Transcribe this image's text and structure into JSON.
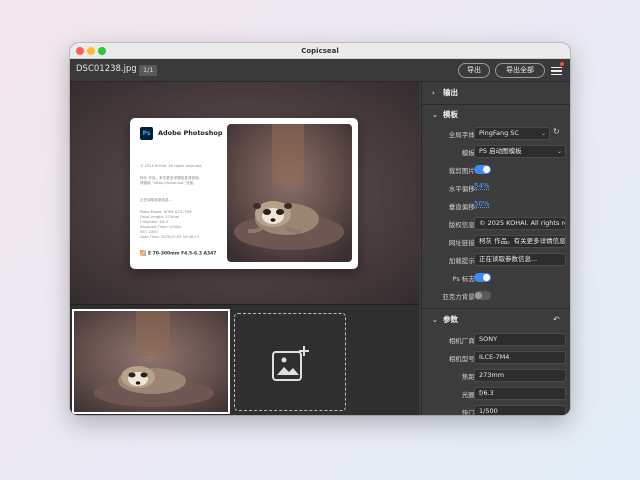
{
  "window": {
    "title": "Copicseal"
  },
  "toolbar": {
    "filename": "DSC01238.jpg",
    "count": "1/1",
    "export_label": "导出",
    "export_all_label": "导出全部",
    "menu_icon": "hamburger-menu-icon"
  },
  "card": {
    "app_icon_label": "Ps",
    "app_name": "Adobe Photoshop",
    "copyright": "© 2025 KOHAI. All rights reserved.",
    "description_1": "柯灰 作品。有关更多详情信息请参阅,",
    "description_2": "请链接 \"https://kohai.top\" 页面。",
    "loading": "正在读取参数信息...",
    "exif_lines": [
      "Make Model: SONY ILCE-7M4",
      "Focal Length: 273mm",
      "F Number: f/6.3",
      "Exposure Time: 1/500s",
      "ISO: 1000",
      "Date Time: 2025:07:05 10:08:23"
    ],
    "lens": "E 70-300mm F4.5-6.3 A347"
  },
  "panel": {
    "output_section": "输出",
    "template_section": "模板",
    "params_section": "参数",
    "template_rows": [
      {
        "label": "全局字体:",
        "value": "PingFang SC"
      },
      {
        "label": "模板:",
        "value": "PS 启动图模板"
      },
      {
        "label": "裁剪图片:",
        "toggle": "on"
      },
      {
        "label": "水平偏移:",
        "value": "54%"
      },
      {
        "label": "垂直偏移:",
        "value": "50%"
      },
      {
        "label": "版权信息:",
        "value": "© 2025 KOHAI. All rights reserved."
      },
      {
        "label": "网址链接:",
        "value": "柯灰 作品。有关更多详情信息请参阅"
      },
      {
        "label": "加载提示:",
        "value": "正在读取参数信息..."
      },
      {
        "label": "Ps 标志:",
        "toggle": "on"
      },
      {
        "label": "亚克力背景:",
        "toggle": "off"
      }
    ],
    "param_rows": [
      {
        "label": "相机厂商:",
        "value": "SONY"
      },
      {
        "label": "相机型号:",
        "value": "ILCE-7M4"
      },
      {
        "label": "焦距:",
        "value": "273mm"
      },
      {
        "label": "光圈:",
        "value": "f/6.3"
      },
      {
        "label": "快门:",
        "value": "1/500"
      }
    ]
  },
  "colors": {
    "accent": "#3b8cf6",
    "link": "#4aa3ff",
    "window_bg": "#3b3b3b",
    "panel_bg": "#3c3c3c"
  }
}
